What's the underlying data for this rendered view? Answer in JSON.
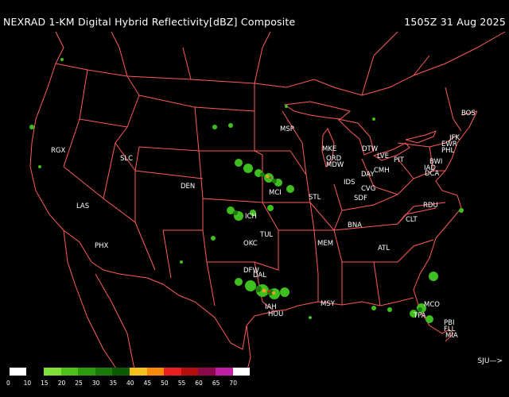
{
  "header": {
    "title": "NEXRAD 1-KM Digital Hybrid Reflectivity[dBZ] Composite",
    "timestamp": "1505Z 31 Aug 2025"
  },
  "stations": [
    "BOS",
    "JFK",
    "EWR",
    "PHL",
    "BWI",
    "IAD",
    "DCA",
    "MSP",
    "MKE",
    "DTW",
    "LVE",
    "PIT",
    "ORD",
    "MDW",
    "DAY",
    "CMH",
    "CVG",
    "SDF",
    "IDS",
    "STL",
    "MCI",
    "ICH",
    "TUL",
    "OKC",
    "DFW",
    "DAL",
    "IAH",
    "HOU",
    "MEM",
    "BNA",
    "ATL",
    "CLT",
    "RDU",
    "MSY",
    "TPA",
    "MCO",
    "PBI",
    "FLL",
    "MIA",
    "RGX",
    "SLC",
    "DEN",
    "LAS",
    "PHX"
  ],
  "legend": {
    "ticks": [
      "0",
      "10",
      "15",
      "20",
      "25",
      "30",
      "35",
      "40",
      "45",
      "50",
      "55",
      "60",
      "65",
      "70"
    ],
    "colors": [
      "#ffffff",
      "#000000",
      "#7fe03c",
      "#4cc21a",
      "#2c9b10",
      "#1b7a08",
      "#0d5a04",
      "#f2c21b",
      "#f58a0c",
      "#ec1f1f",
      "#b50e0e",
      "#8a0a4a",
      "#c21ea8",
      "#ffffff"
    ]
  },
  "credit": "SJU—>"
}
